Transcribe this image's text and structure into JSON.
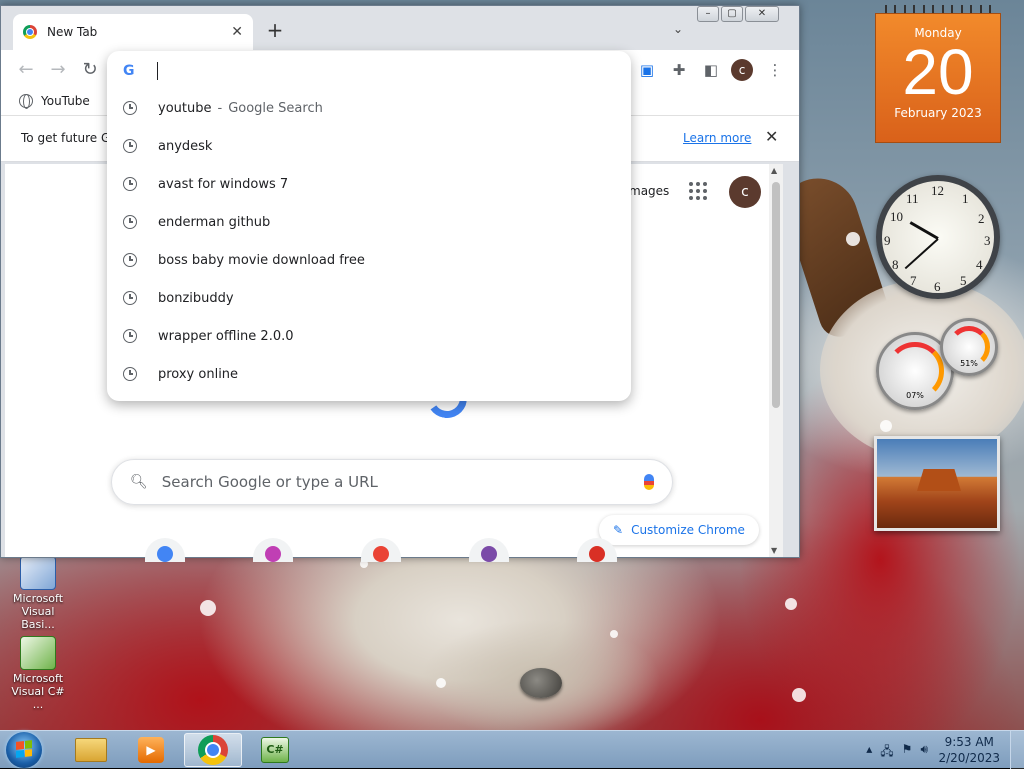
{
  "browser": {
    "tab_title": "New Tab",
    "new_tab_symbol": "+",
    "bookmark_youtube": "YouTube",
    "infobar_text": "To get future G",
    "infobar_link": "Learn more",
    "page_images_link": "mages",
    "avatar_letter": "c",
    "search_placeholder": "Search Google or type a URL",
    "customize_label": "Customize Chrome"
  },
  "omnibox": {
    "google_glyph": "G",
    "suggestions": [
      {
        "text": "youtube",
        "suffix": "Google Search"
      },
      {
        "text": "anydesk"
      },
      {
        "text": "avast for windows 7"
      },
      {
        "text": "enderman github"
      },
      {
        "text": "boss baby movie download free"
      },
      {
        "text": "bonzibuddy"
      },
      {
        "text": "wrapper offline 2.0.0"
      },
      {
        "text": "proxy online"
      }
    ],
    "suffix_separator": "-"
  },
  "gadgets": {
    "calendar": {
      "weekday": "Monday",
      "day": "20",
      "month": "February 2023"
    },
    "clock_numbers": [
      "12",
      "1",
      "2",
      "3",
      "4",
      "5",
      "6",
      "7",
      "8",
      "9",
      "10",
      "11"
    ],
    "cpu_meter": {
      "value": "07%"
    },
    "ram_meter": {
      "value": "51%"
    }
  },
  "desktop_icons": [
    {
      "label": "Microsoft Visual Basi..."
    },
    {
      "label": "Microsoft Visual C# ..."
    }
  ],
  "taskbar": {
    "time": "9:53 AM",
    "date": "2/20/2023",
    "cs_label": "C#"
  }
}
